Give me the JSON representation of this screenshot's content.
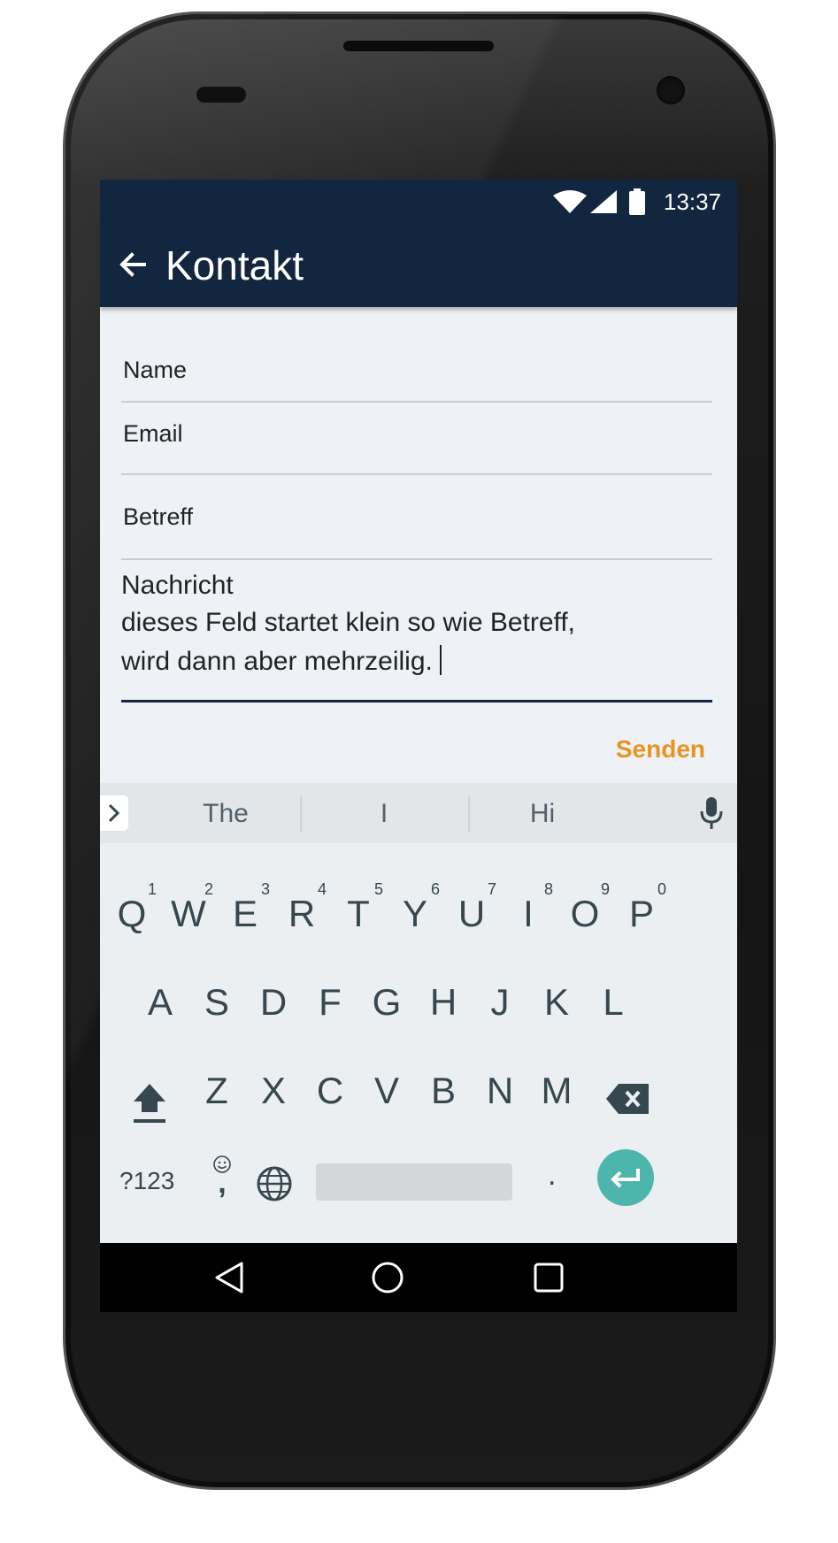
{
  "status": {
    "time": "13:37"
  },
  "appbar": {
    "title": "Kontakt"
  },
  "form": {
    "name_label": "Name",
    "email_label": "Email",
    "subject_label": "Betreff",
    "message_label": "Nachricht",
    "message_line1": "dieses Feld startet klein so wie Betreff,",
    "message_line2": "wird dann aber mehrzeilig.",
    "send_label": "Senden"
  },
  "keyboard": {
    "suggestions": [
      "The",
      "I",
      "Hi"
    ],
    "row1": [
      "Q",
      "W",
      "E",
      "R",
      "T",
      "Y",
      "U",
      "I",
      "O",
      "P"
    ],
    "row1_hints": [
      "1",
      "2",
      "3",
      "4",
      "5",
      "6",
      "7",
      "8",
      "9",
      "0"
    ],
    "row2": [
      "A",
      "S",
      "D",
      "F",
      "G",
      "H",
      "J",
      "K",
      "L"
    ],
    "row3": [
      "Z",
      "X",
      "C",
      "V",
      "B",
      "N",
      "M"
    ],
    "symbols_label": "?123",
    "comma_label": ",",
    "period_label": "."
  },
  "icons": {
    "status": [
      "wifi-icon",
      "signal-icon",
      "battery-icon"
    ],
    "appbar": [
      "back-arrow-icon"
    ],
    "keyboard": [
      "chevron-right-icon",
      "mic-icon",
      "shift-icon",
      "backspace-icon",
      "emoji-icon",
      "globe-icon",
      "enter-icon"
    ],
    "navbar": [
      "nav-back-icon",
      "nav-home-icon",
      "nav-recent-icon"
    ]
  },
  "colors": {
    "appbar_bg": "#12263f",
    "screen_bg": "#eef1f5",
    "accent": "#e79520",
    "enter_key": "#4db6ac"
  }
}
